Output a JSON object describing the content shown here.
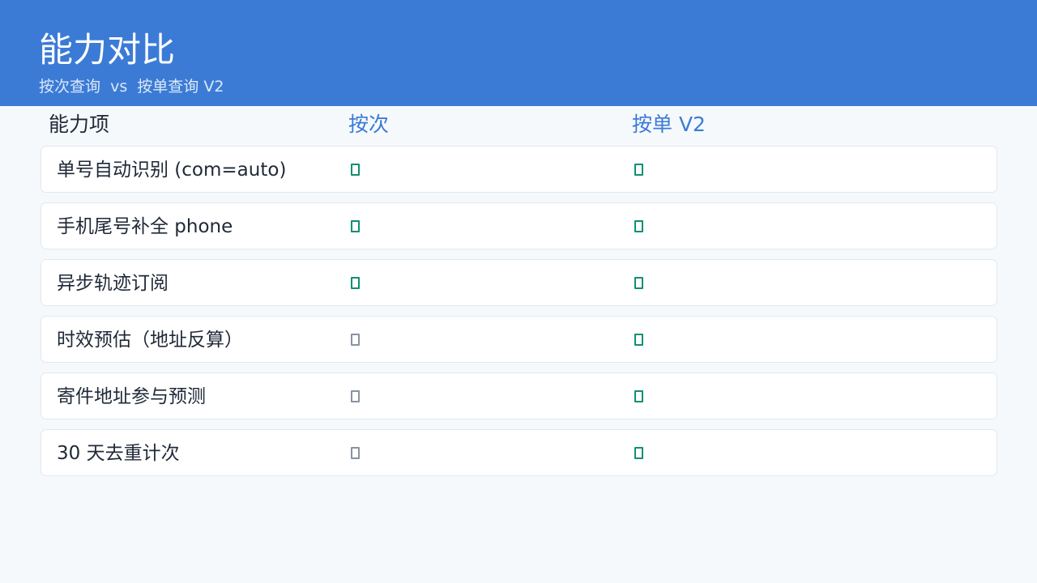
{
  "header": {
    "title": "能力对比",
    "subtitle": "按次查询  vs  按单查询 V2"
  },
  "table": {
    "columns": [
      "能力项",
      "按次",
      "按单 V2"
    ],
    "rows": [
      {
        "label": "单号自动识别 (com=auto)",
        "per_query": "supported",
        "per_order": "supported"
      },
      {
        "label": "手机尾号补全 phone",
        "per_query": "supported",
        "per_order": "supported"
      },
      {
        "label": "异步轨迹订阅",
        "per_query": "supported",
        "per_order": "supported"
      },
      {
        "label": "时效预估（地址反算）",
        "per_query": "unsupported",
        "per_order": "supported"
      },
      {
        "label": "寄件地址参与预测",
        "per_query": "unsupported",
        "per_order": "supported"
      },
      {
        "label": "30 天去重计次",
        "per_query": "unsupported",
        "per_order": "supported"
      }
    ]
  },
  "colors": {
    "accent": "#3b7bd6",
    "supported": "#0f8f73",
    "unsupported": "#8793a3"
  },
  "icons": {
    "supported": "check-box-icon",
    "unsupported": "empty-box-icon"
  }
}
